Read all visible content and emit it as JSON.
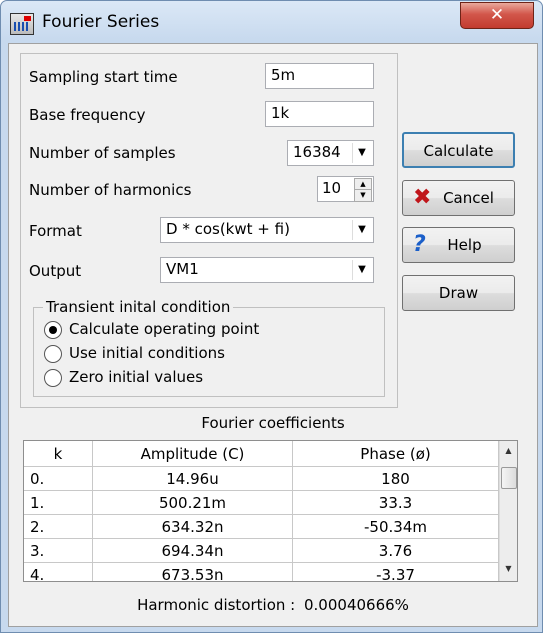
{
  "window": {
    "title": "Fourier Series",
    "close_symbol": "✕"
  },
  "fields": {
    "sampling_start_time": {
      "label": "Sampling start time",
      "value": "5m"
    },
    "base_frequency": {
      "label": "Base frequency",
      "value": "1k"
    },
    "number_of_samples": {
      "label": "Number of samples",
      "value": "16384"
    },
    "number_of_harmonics": {
      "label": "Number of harmonics",
      "value": "10"
    },
    "format": {
      "label": "Format",
      "value": "D * cos(kwt + fi)"
    },
    "output": {
      "label": "Output",
      "value": "VM1"
    }
  },
  "transient": {
    "legend": "Transient inital condition",
    "options": [
      "Calculate operating point",
      "Use initial conditions",
      "Zero initial values"
    ],
    "selected_index": 0
  },
  "buttons": {
    "calculate": "Calculate",
    "cancel": "Cancel",
    "help": "Help",
    "draw": "Draw"
  },
  "icons": {
    "cancel": "red-x-icon",
    "help": "question-mark-icon",
    "app": "fourier-app-icon"
  },
  "coefficients": {
    "title": "Fourier coefficients",
    "columns": [
      "k",
      "Amplitude (C)",
      "Phase (ø)"
    ],
    "rows": [
      [
        "0.",
        "14.96u",
        "180"
      ],
      [
        "1.",
        "500.21m",
        "33.3"
      ],
      [
        "2.",
        "634.32n",
        "-50.34m"
      ],
      [
        "3.",
        "694.34n",
        "3.76"
      ],
      [
        "4.",
        "673.53n",
        "-3.37"
      ]
    ]
  },
  "distortion": {
    "label": "Harmonic distortion :",
    "value": "0.00040666%"
  },
  "colors": {
    "cancel_icon": "#c0161b",
    "help_icon": "#1b5fc9"
  }
}
